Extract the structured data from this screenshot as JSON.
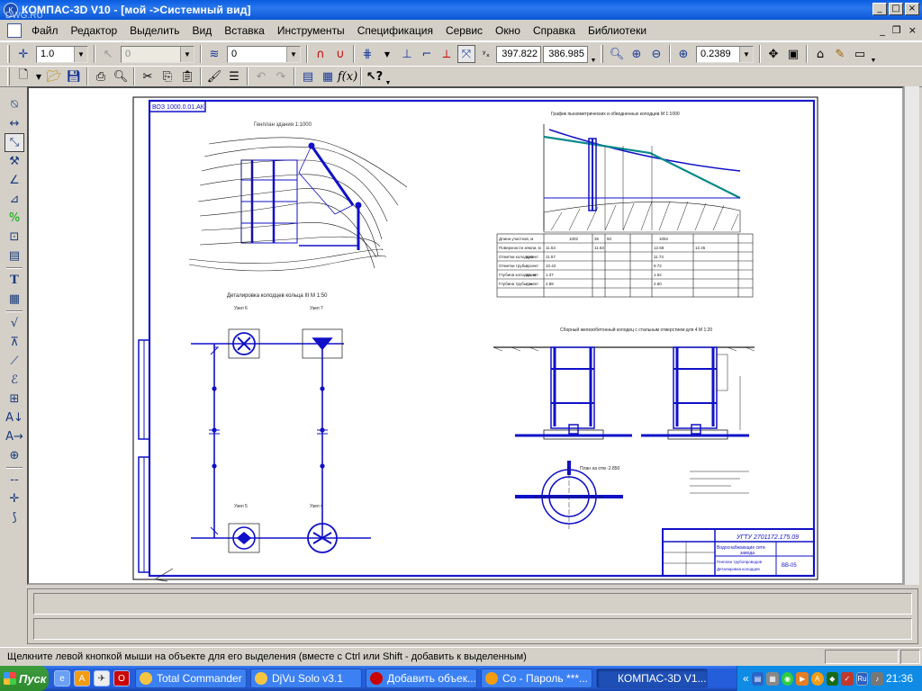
{
  "window": {
    "title": "КОМПАС-3D V10 - [мой ->Системный вид]",
    "watermark": "DWG.RU",
    "min_label": "_",
    "max_label": "□",
    "close_label": "×"
  },
  "menu": {
    "items": [
      "Файл",
      "Редактор",
      "Выделить",
      "Вид",
      "Вставка",
      "Инструменты",
      "Спецификация",
      "Сервис",
      "Окно",
      "Справка",
      "Библиотеки"
    ]
  },
  "toolbar1": {
    "step_value": "1.0",
    "angle_value": "0",
    "layer_value": "0",
    "x_value": "397.822",
    "y_value": "386.985",
    "zoom_value": "0.2389"
  },
  "drawing": {
    "stamp_top": "ВОЗ 1000.0.01.АК",
    "plan_title": "Генплан здания 1:1000",
    "detail_title": "Деталировка колодцев кольца III М 1:50",
    "uz6": "Узел 6",
    "uz7": "Узел 7",
    "uz5": "Узел 5",
    "uz4": "Узел 4",
    "profile_title": "График пьезометрических и обводненных колодцев М 1:1000",
    "well_title": "Сборный железобетонный колодец с стальным отверстием для 4 М 1:20",
    "plan_well": "План на отм -2.850",
    "tb_code": "УГТУ 2701172.175.09",
    "tb_name": "Водоснабжающие сети",
    "tb_sub": "завода",
    "tb_line3": "Генплан трубопроводов",
    "tb_line4": "Деталировка колодцев",
    "tb_sheet": "ВВ-05",
    "profile_rows": [
      [
        "Длина участков, м",
        "1002",
        "35",
        "50",
        "1052"
      ],
      [
        "Поверхности земли, м",
        "11.53",
        "11.63",
        "12.68",
        "12.45"
      ],
      [
        "Отметки колодцев",
        "проект",
        "11.57",
        "11.73"
      ],
      [
        "Отметки трубы",
        "проект",
        "10.42",
        "9.72"
      ],
      [
        "Глубина колодца, м",
        "проект",
        "1.37",
        "1.62"
      ],
      [
        "Глубина трубы, м",
        "проект",
        "2.88",
        "2.60"
      ]
    ]
  },
  "status": {
    "text": "Щелкните левой кнопкой мыши на объекте для его выделения (вместе с Ctrl или Shift - добавить к выделенным)"
  },
  "taskbar": {
    "start": "Пуск",
    "tasks": [
      "Total Commander ...",
      "DjVu Solo v3.1",
      "Добавить объек...",
      "Со - Пароль ***...",
      "КОМПАС-3D V1..."
    ],
    "lang": "Ru",
    "clock": "21:36"
  }
}
